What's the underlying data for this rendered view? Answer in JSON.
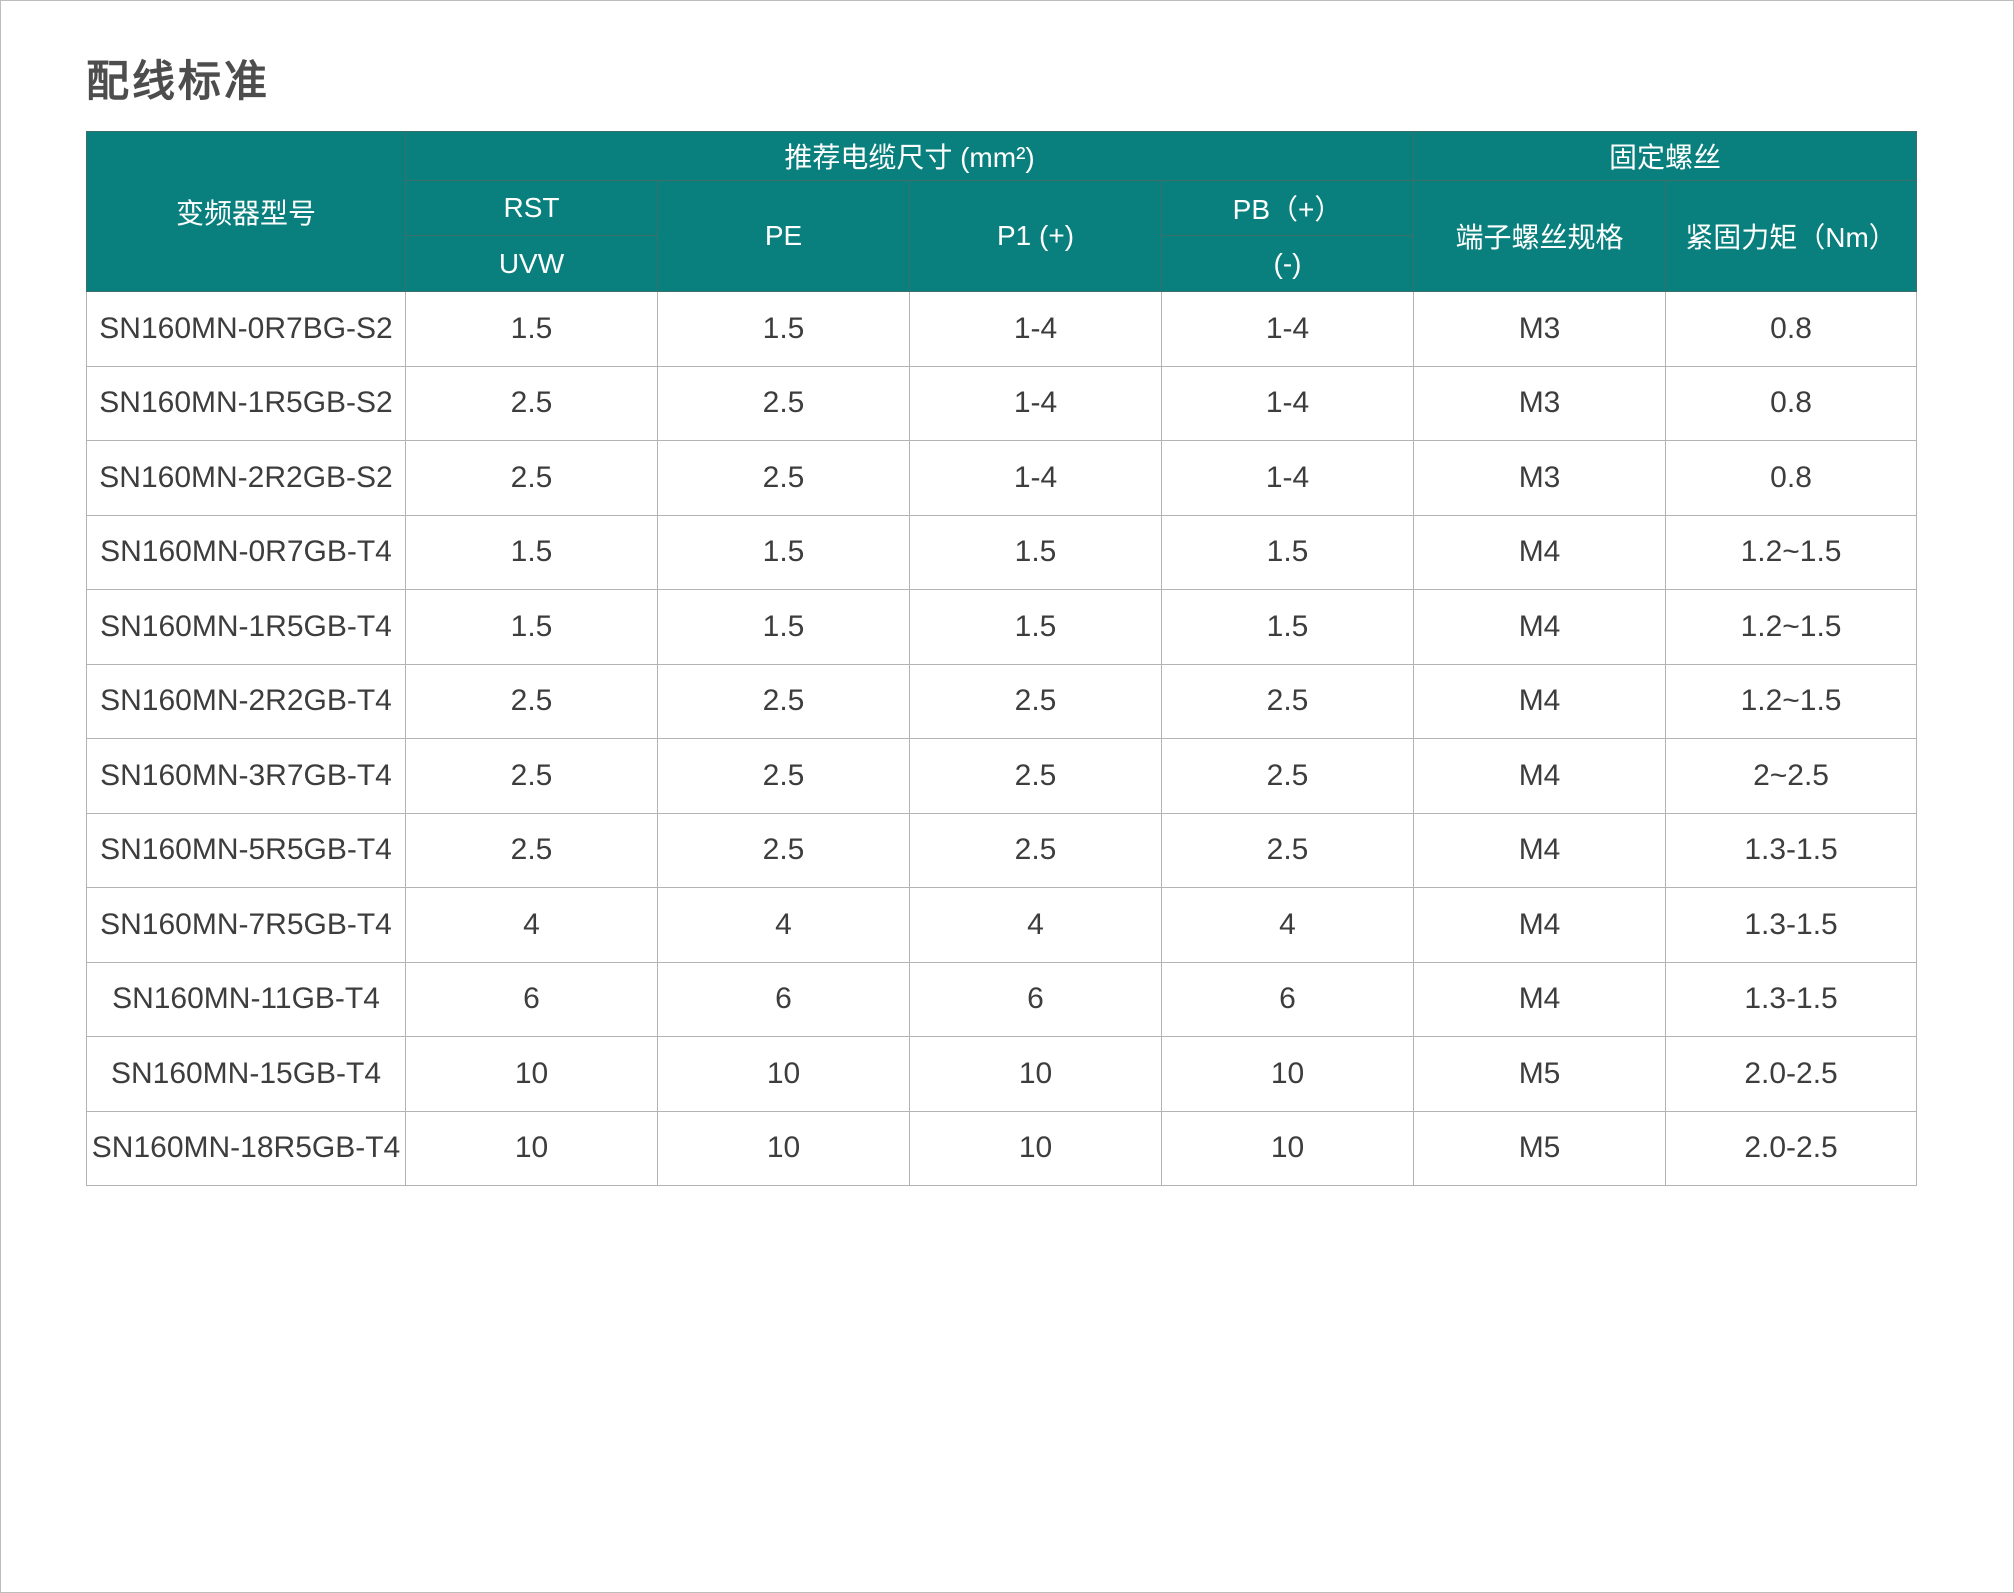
{
  "page": {
    "title": "配线标准"
  },
  "colors": {
    "header_bg": "#0a807e",
    "header_text": "#ffffff",
    "model_cell_bg": "#f4f5f6",
    "body_text": "#3d3d3d"
  },
  "table": {
    "header": {
      "model_col": "变频器型号",
      "group_cable": "推荐电缆尺寸 (mm²)",
      "group_screw": "固定螺丝",
      "sub": {
        "rst": "RST",
        "uvw": "UVW",
        "pe": "PE",
        "p1": "P1 (+)",
        "pb": "PB（+）",
        "minus": "(-)",
        "terminal_screw": "端子螺丝规格",
        "torque": "紧固力矩（Nm）"
      }
    },
    "rows": [
      {
        "model": "SN160MN-0R7BG-S2",
        "values": [
          "1.5",
          "1.5",
          "1-4",
          "1-4",
          "M3",
          "0.8"
        ]
      },
      {
        "model": "SN160MN-1R5GB-S2",
        "values": [
          "2.5",
          "2.5",
          "1-4",
          "1-4",
          "M3",
          "0.8"
        ]
      },
      {
        "model": "SN160MN-2R2GB-S2",
        "values": [
          "2.5",
          "2.5",
          "1-4",
          "1-4",
          "M3",
          "0.8"
        ]
      },
      {
        "model": "SN160MN-0R7GB-T4",
        "values": [
          "1.5",
          "1.5",
          "1.5",
          "1.5",
          "M4",
          "1.2~1.5"
        ]
      },
      {
        "model": "SN160MN-1R5GB-T4",
        "values": [
          "1.5",
          "1.5",
          "1.5",
          "1.5",
          "M4",
          "1.2~1.5"
        ]
      },
      {
        "model": "SN160MN-2R2GB-T4",
        "values": [
          "2.5",
          "2.5",
          "2.5",
          "2.5",
          "M4",
          "1.2~1.5"
        ]
      },
      {
        "model": "SN160MN-3R7GB-T4",
        "values": [
          "2.5",
          "2.5",
          "2.5",
          "2.5",
          "M4",
          "2~2.5"
        ]
      },
      {
        "model": "SN160MN-5R5GB-T4",
        "values": [
          "2.5",
          "2.5",
          "2.5",
          "2.5",
          "M4",
          "1.3-1.5"
        ]
      },
      {
        "model": "SN160MN-7R5GB-T4",
        "values": [
          "4",
          "4",
          "4",
          "4",
          "M4",
          "1.3-1.5"
        ]
      },
      {
        "model": "SN160MN-11GB-T4",
        "values": [
          "6",
          "6",
          "6",
          "6",
          "M4",
          "1.3-1.5"
        ]
      },
      {
        "model": "SN160MN-15GB-T4",
        "values": [
          "10",
          "10",
          "10",
          "10",
          "M5",
          "2.0-2.5"
        ]
      },
      {
        "model": "SN160MN-18R5GB-T4",
        "values": [
          "10",
          "10",
          "10",
          "10",
          "M5",
          "2.0-2.5"
        ]
      }
    ]
  }
}
